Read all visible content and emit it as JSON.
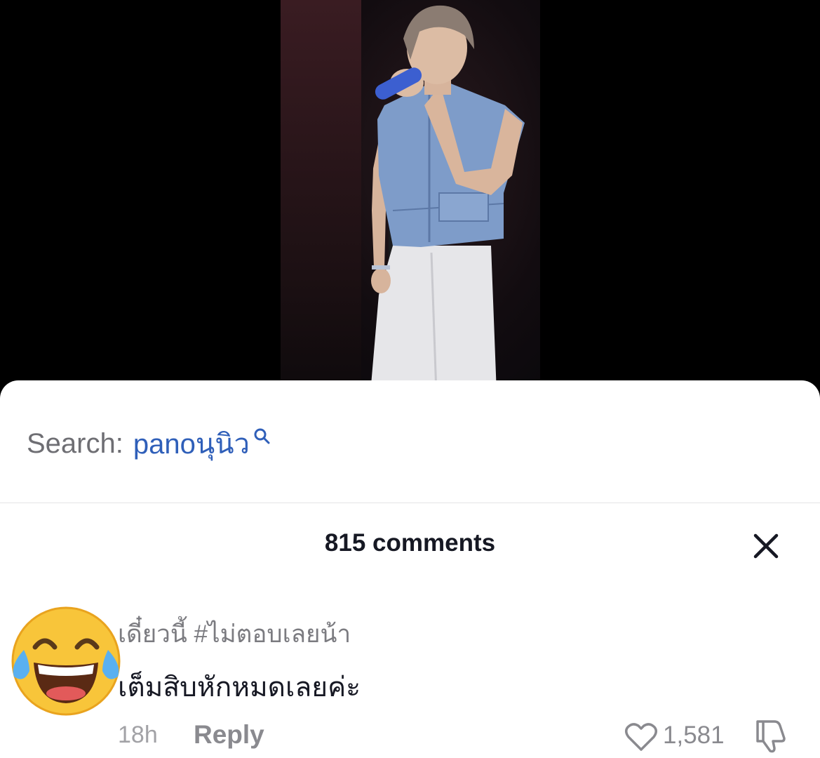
{
  "video": {
    "description_icon": "performer-video",
    "thumbnail_colors": {
      "vest": "#7e9cc9",
      "pants": "#e8e8ea",
      "mic": "#3c5fd0"
    }
  },
  "search": {
    "label": "Search:",
    "query": "panoนุนิว",
    "icon": "search-icon",
    "accent_color": "#2f5fb9"
  },
  "comments": {
    "title": "815 comments",
    "close_icon": "close-icon"
  },
  "comment": {
    "avatar": "tears-of-joy-emoji",
    "username": "เดี๋ยวนี้ #ไม่ตอบเลยน้า",
    "text": "เต็มสิบหักหมดเลยค่ะ",
    "time": "18h",
    "reply_label": "Reply",
    "like_count": "1,581",
    "like_icon": "heart-icon",
    "dislike_icon": "thumbs-down-icon"
  }
}
